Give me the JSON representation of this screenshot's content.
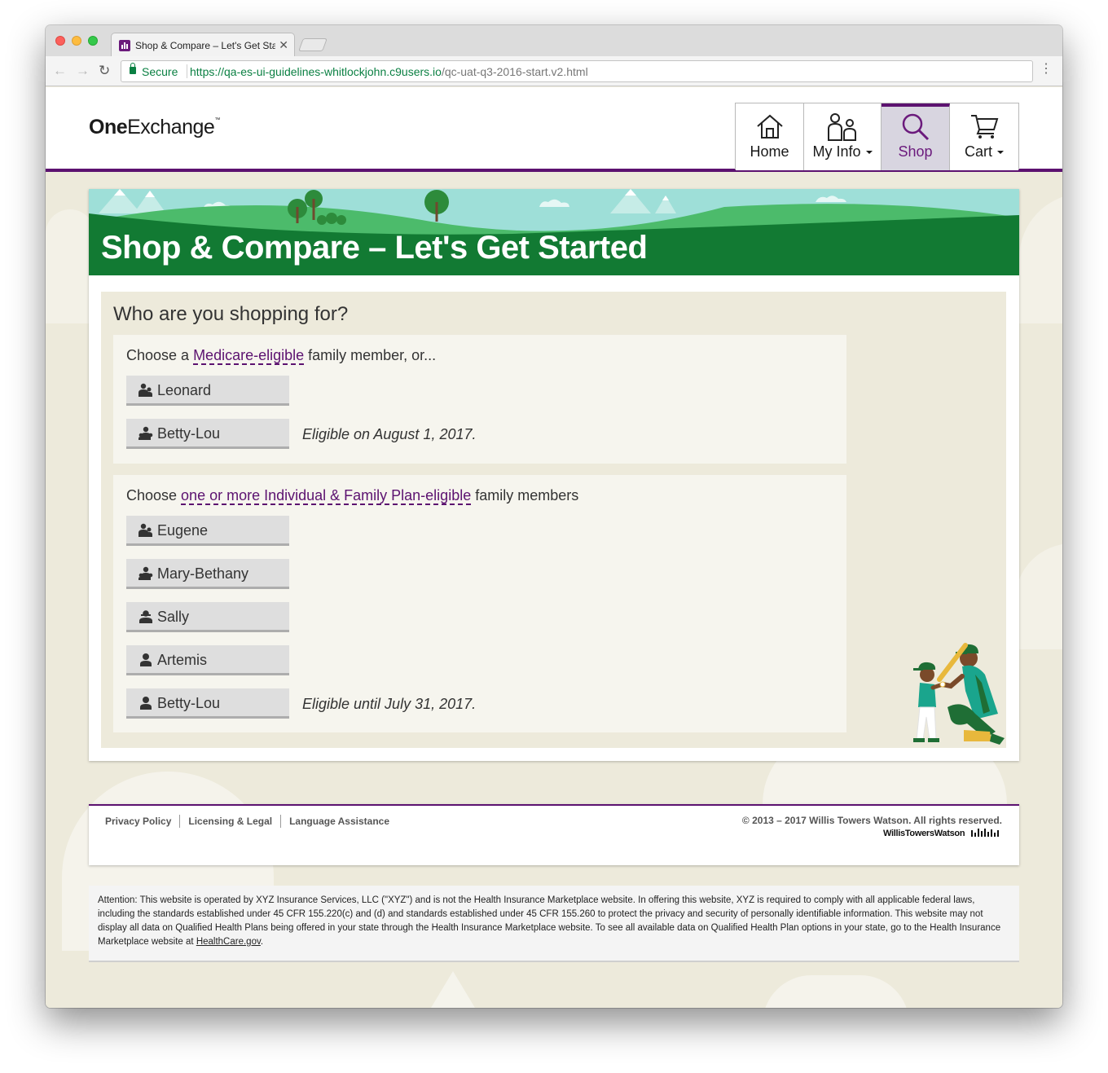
{
  "browser": {
    "tab_title": "Shop & Compare – Let's Get Started",
    "security_label": "Secure",
    "url_host": "https://qa-es-ui-guidelines-whitlockjohn.c9users.io",
    "url_path": "/qc-uat-q3-2016-start.v2.html"
  },
  "header": {
    "logo_bold": "One",
    "logo_rest": "Exchange",
    "logo_tm": "™",
    "nav": [
      {
        "label": "Home",
        "icon": "house-icon",
        "active": false,
        "dropdown": false
      },
      {
        "label": "My Info",
        "icon": "people-icon",
        "active": false,
        "dropdown": true
      },
      {
        "label": "Shop",
        "icon": "magnifier-icon",
        "active": true,
        "dropdown": false
      },
      {
        "label": "Cart",
        "icon": "cart-icon",
        "active": false,
        "dropdown": true
      }
    ]
  },
  "hero": {
    "title": "Shop & Compare – Let's Get Started"
  },
  "main": {
    "heading": "Who are you shopping for?",
    "medicare_section": {
      "prefix": "Choose a ",
      "link": "Medicare-eligible",
      "suffix": " family member, or...",
      "members": [
        {
          "name": "Leonard",
          "icon": "person-couple-icon",
          "note": ""
        },
        {
          "name": "Betty-Lou",
          "icon": "person-couple-icon",
          "note": "Eligible on August 1, 2017."
        }
      ]
    },
    "ifp_section": {
      "prefix": "Choose ",
      "link": "one or more Individual & Family Plan-eligible",
      "suffix": " family members",
      "members": [
        {
          "name": "Eugene",
          "icon": "person-couple-icon",
          "note": ""
        },
        {
          "name": "Mary-Bethany",
          "icon": "person-couple-icon",
          "note": ""
        },
        {
          "name": "Sally",
          "icon": "person-icon",
          "note": ""
        },
        {
          "name": "Artemis",
          "icon": "person-icon",
          "note": ""
        },
        {
          "name": "Betty-Lou",
          "icon": "person-icon",
          "note": "Eligible until July 31, 2017."
        }
      ]
    }
  },
  "footer": {
    "links": [
      "Privacy Policy",
      "Licensing & Legal",
      "Language Assistance"
    ],
    "copyright": "© 2013 – 2017 Willis Towers Watson. All rights reserved.",
    "brand": "WillisTowersWatson"
  },
  "disclaimer": {
    "text": "Attention: This website is operated by XYZ Insurance Services, LLC (\"XYZ\") and is not the Health Insurance Marketplace website. In offering this website, XYZ is required to comply with all applicable federal laws, including the standards established under 45 CFR 155.220(c) and (d) and standards established under 45 CFR 155.260 to protect the privacy and security of personally identifiable information. This website may not display all data on Qualified Health Plans being offered in your state through the Health Insurance Marketplace website. To see all available data on Qualified Health Plan options in your state, go to the Health Insurance Marketplace website at ",
    "link": "HealthCare.gov",
    "end": "."
  },
  "colors": {
    "brand_purple": "#5c1270",
    "hero_green": "#127a33",
    "page_bg": "#edeadb"
  }
}
